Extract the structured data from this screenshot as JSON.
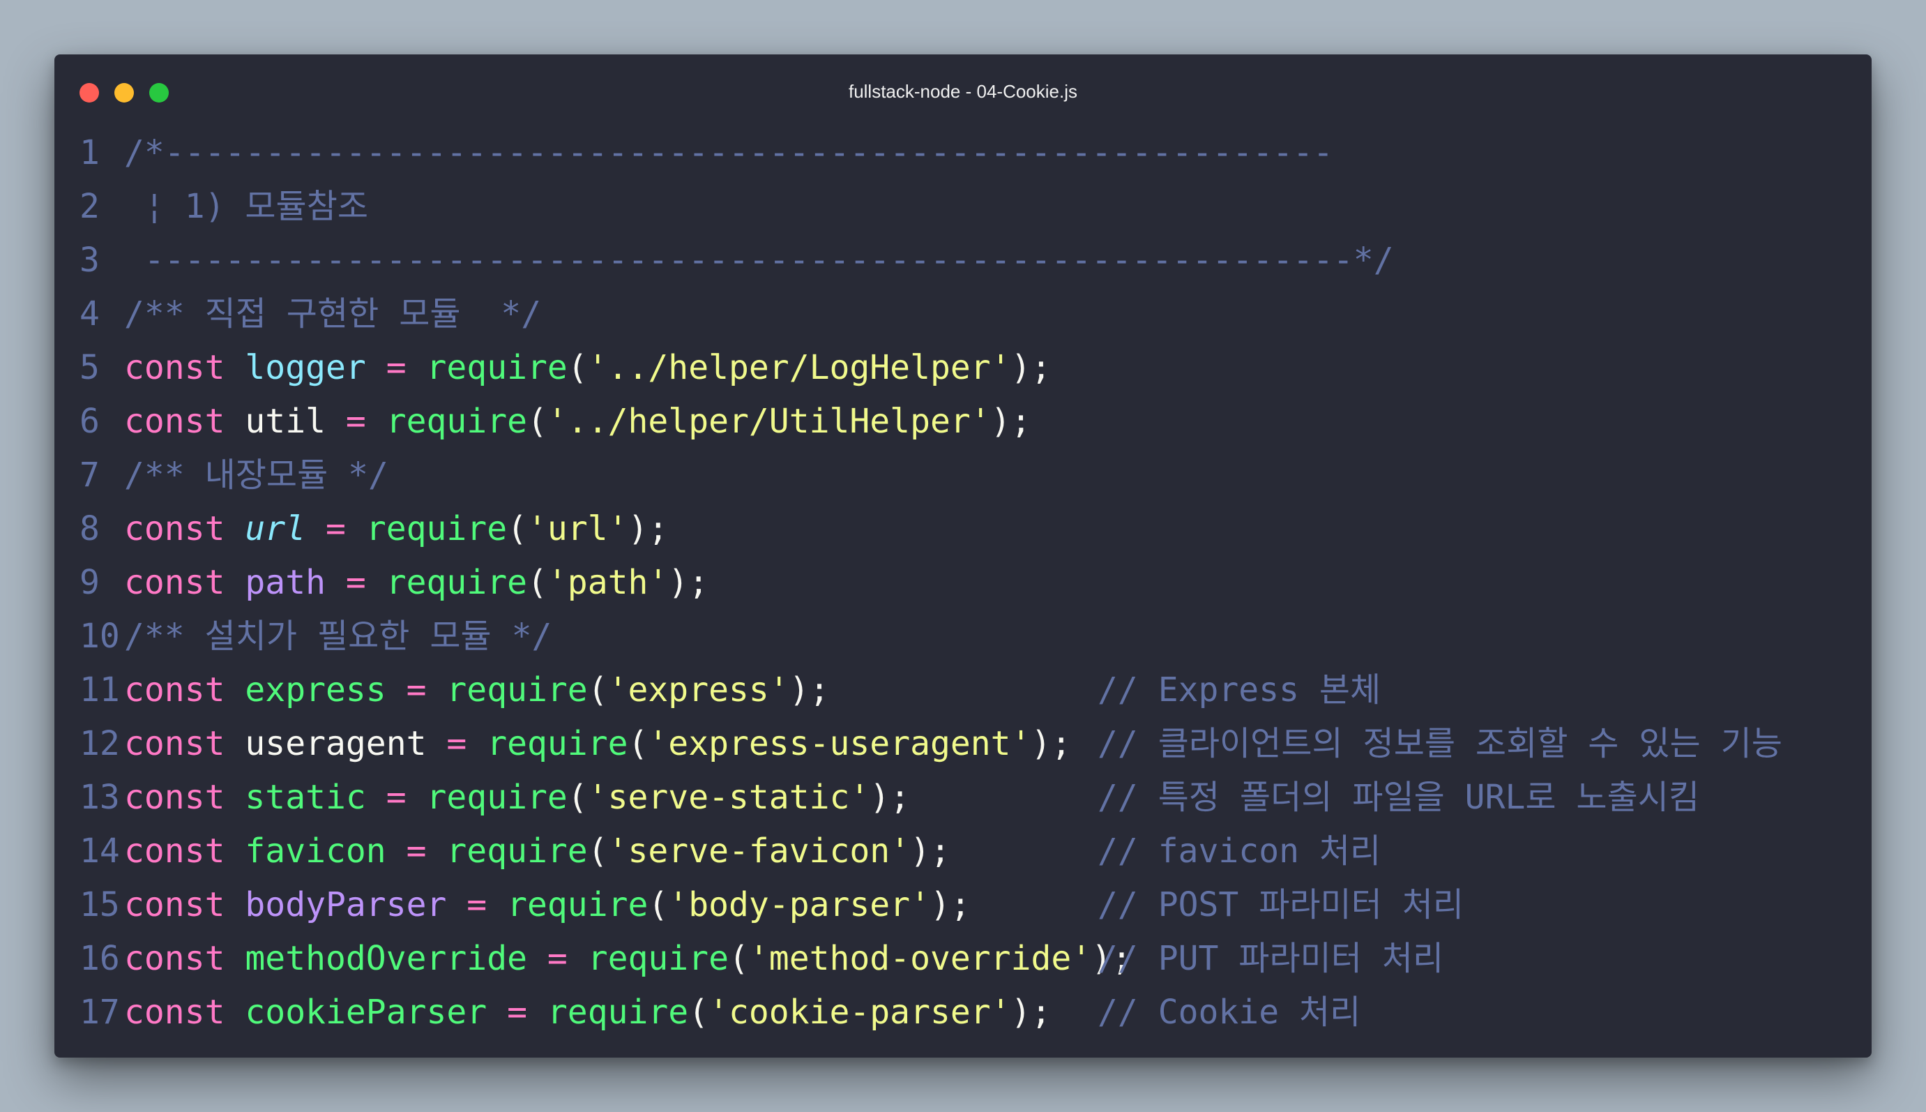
{
  "window": {
    "title": "fullstack-node - 04-Cookie.js"
  },
  "lines": [
    {
      "n": "1",
      "comment": "/*----------------------------------------------------------"
    },
    {
      "n": "2",
      "comment": " ¦ 1) 모듈참조"
    },
    {
      "n": "3",
      "comment": " ------------------------------------------------------------*/"
    },
    {
      "n": "4",
      "comment": "/** 직접 구현한 모듈  */"
    },
    {
      "n": "5",
      "kw": "const",
      "var": "logger",
      "op": " = ",
      "fn": "require",
      "open": "(",
      "str": "'../helper/LogHelper'",
      "close": ");"
    },
    {
      "n": "6",
      "kw": "const",
      "var": "util",
      "op": " = ",
      "fn": "require",
      "open": "(",
      "str": "'../helper/UtilHelper'",
      "close": ");"
    },
    {
      "n": "7",
      "comment": "/** 내장모듈 */"
    },
    {
      "n": "8",
      "kw": "const",
      "var": "url",
      "op": " = ",
      "fn": "require",
      "open": "(",
      "str": "'url'",
      "close": ");"
    },
    {
      "n": "9",
      "kw": "const",
      "var": "path",
      "op": " = ",
      "fn": "require",
      "open": "(",
      "str": "'path'",
      "close": ");"
    },
    {
      "n": "10",
      "comment": "/** 설치가 필요한 모듈 */"
    },
    {
      "n": "11",
      "kw": "const",
      "var": "express",
      "op": " = ",
      "fn": "require",
      "open": "(",
      "str": "'express'",
      "close": ");",
      "trail": "// Express 본체"
    },
    {
      "n": "12",
      "kw": "const",
      "var": "useragent",
      "op": " = ",
      "fn": "require",
      "open": "(",
      "str": "'express-useragent'",
      "close": ");",
      "trail": "// 클라이언트의 정보를 조회할 수 있는 기능"
    },
    {
      "n": "13",
      "kw": "const",
      "var": "static",
      "op": " = ",
      "fn": "require",
      "open": "(",
      "str": "'serve-static'",
      "close": ");",
      "trail": "// 특정 폴더의 파일을 URL로 노출시킴"
    },
    {
      "n": "14",
      "kw": "const",
      "var": "favicon",
      "op": " = ",
      "fn": "require",
      "open": "(",
      "str": "'serve-favicon'",
      "close": ");",
      "trail": "// favicon 처리"
    },
    {
      "n": "15",
      "kw": "const",
      "var": "bodyParser",
      "op": " = ",
      "fn": "require",
      "open": "(",
      "str": "'body-parser'",
      "close": ");",
      "trail": "// POST 파라미터 처리"
    },
    {
      "n": "16",
      "kw": "const",
      "var": "methodOverride",
      "op": " = ",
      "fn": "require",
      "open": "(",
      "str": "'method-override'",
      "close": ");",
      "trail": "// PUT 파라미터 처리"
    },
    {
      "n": "17",
      "kw": "const",
      "var": "cookieParser",
      "op": " = ",
      "fn": "require",
      "open": "(",
      "str": "'cookie-parser'",
      "close": ");",
      "trail": "// Cookie 처리"
    }
  ],
  "colors": {
    "background": "#282a36",
    "comment": "#6272a4",
    "keyword": "#ff79c6",
    "function": "#50fa7b",
    "string": "#f1fa8c",
    "plain": "#f8f8f2",
    "cyan": "#8be9fd",
    "purple": "#bd93f9"
  }
}
